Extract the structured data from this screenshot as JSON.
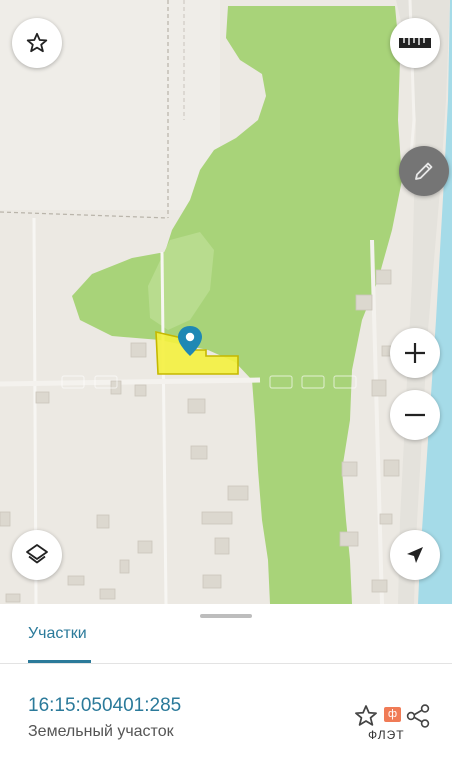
{
  "map": {
    "icons": {
      "favorite": "star-outline-icon",
      "ruler": "ruler-icon",
      "edit": "pencil-icon",
      "zoom_in": "plus-icon",
      "zoom_out": "minus-icon",
      "layers": "layers-icon",
      "locate": "navigation-arrow-icon",
      "marker": "map-pin-icon"
    },
    "colors": {
      "land": "#ece9e3",
      "forest": "#a8d379",
      "water": "#a5dbe8",
      "building": "#dedad2",
      "road": "#f7f6f3",
      "parcel_fill": "#f4f13e",
      "parcel_outline": "#c5b800",
      "marker": "#1f88b4"
    }
  },
  "sheet": {
    "tabs": [
      {
        "label": "Участки",
        "active": true
      }
    ],
    "parcel": {
      "cadastral_number": "16:15:050401:285",
      "type": "Земельный участок"
    },
    "watermark": {
      "badge": "ф",
      "text": "ФЛЭТ"
    },
    "icons": {
      "favorite": "star-outline-icon",
      "share": "share-icon"
    },
    "accent_color": "#2b7a9a"
  }
}
